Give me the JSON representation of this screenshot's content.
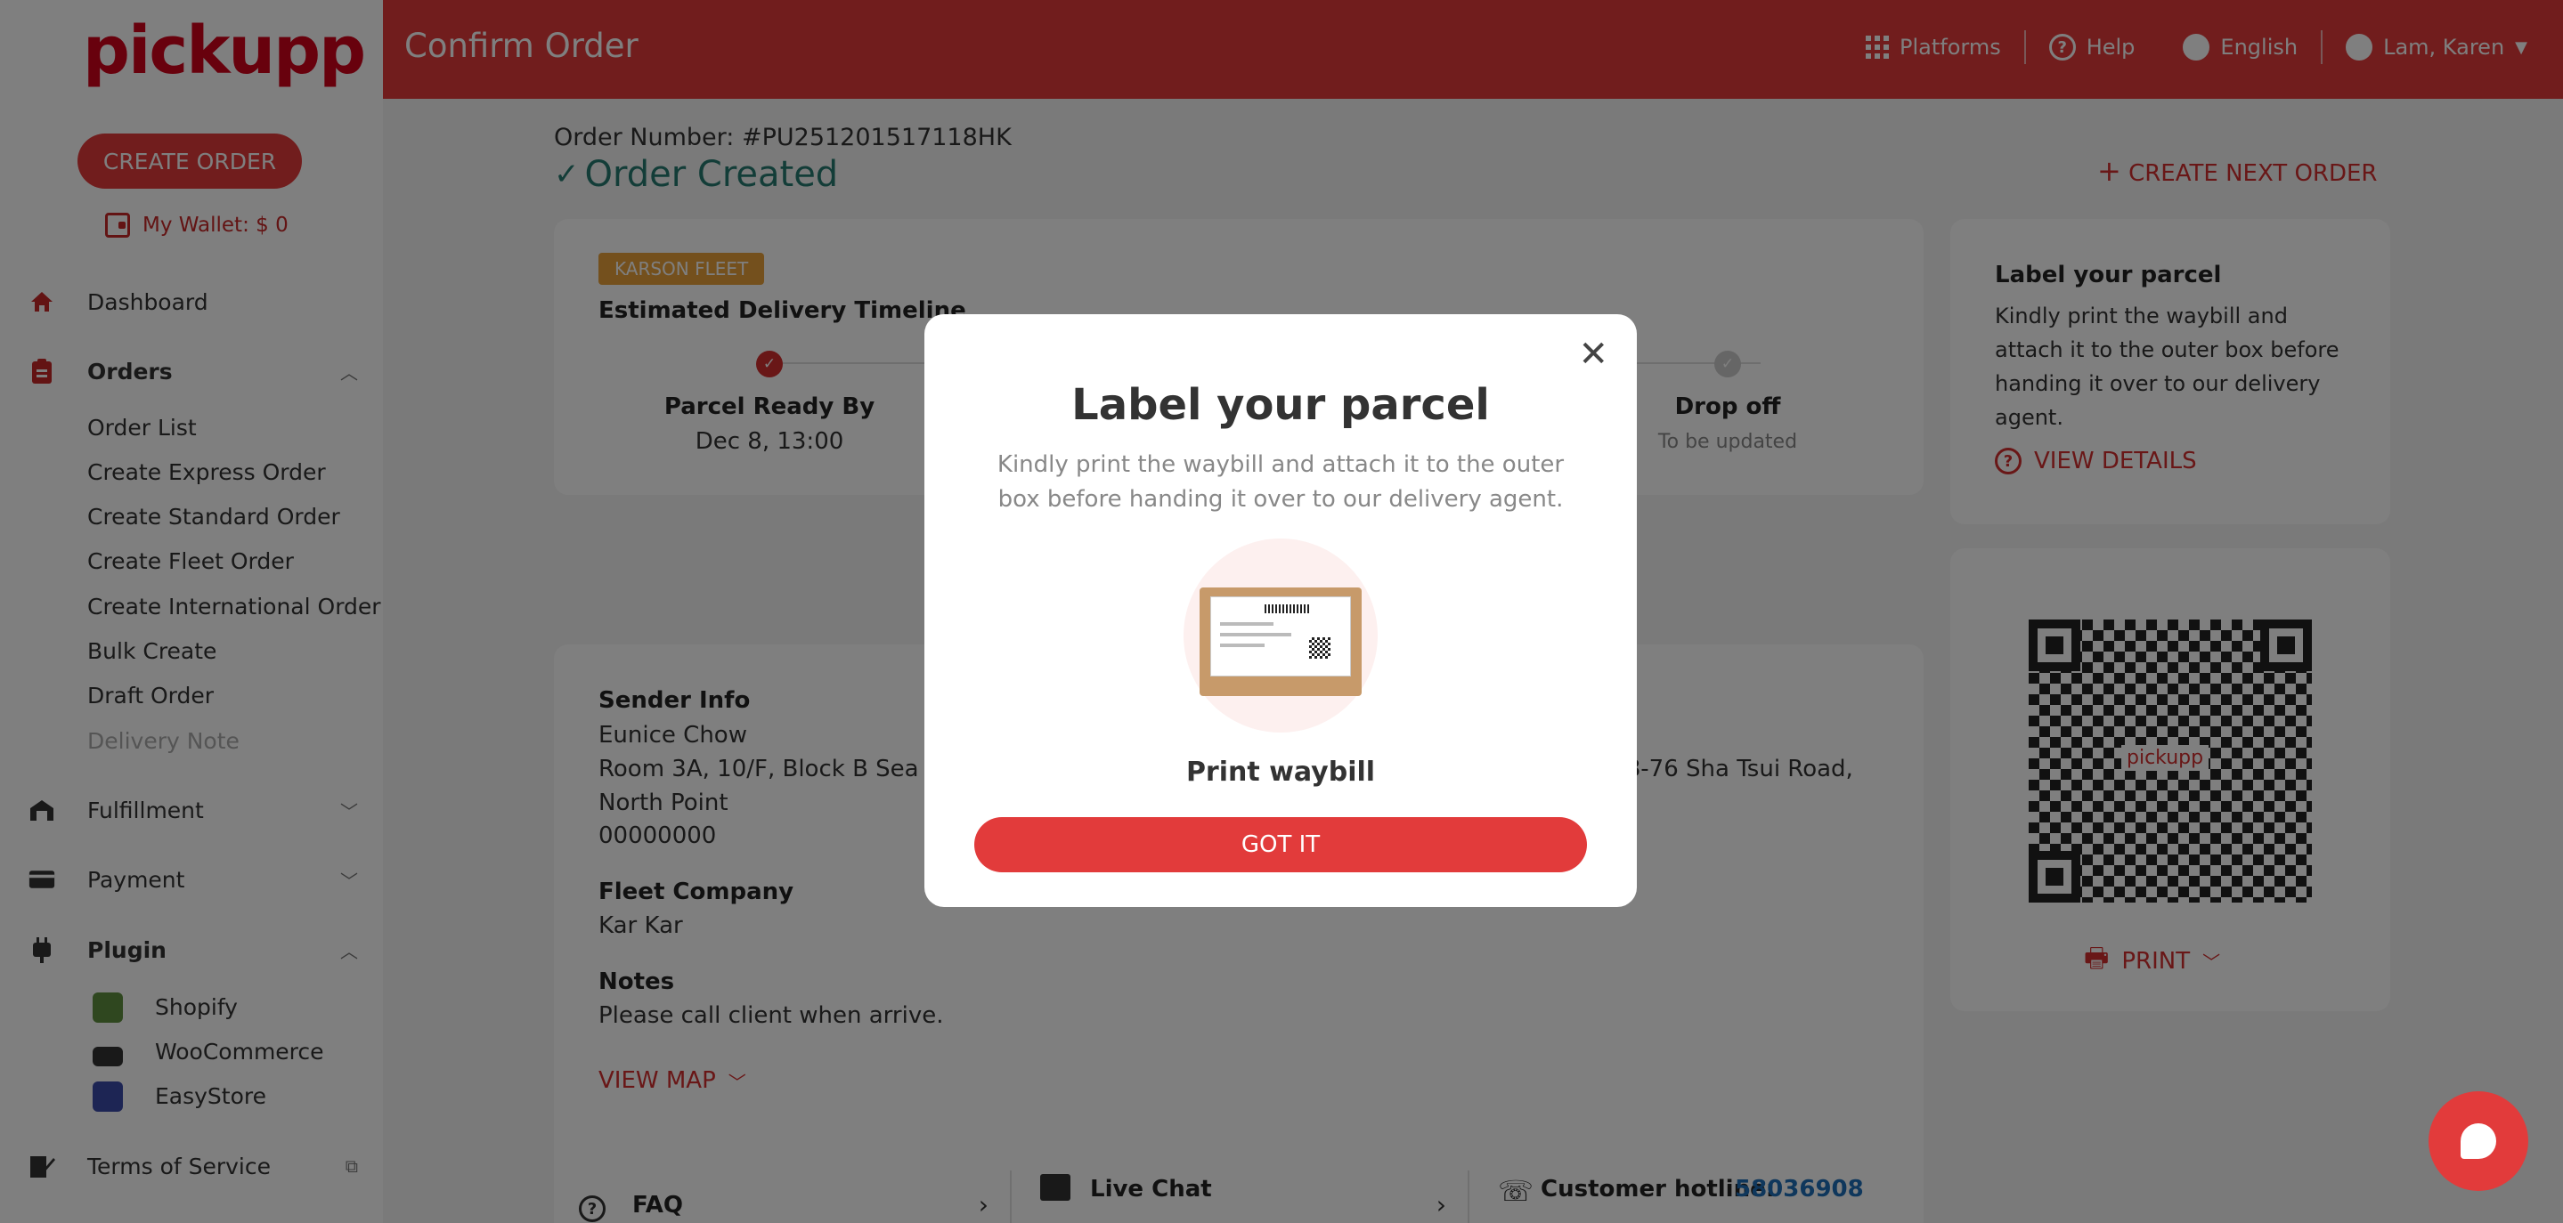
{
  "app": {
    "logo": "pickupp",
    "page_title": "Confirm Order"
  },
  "sidebar": {
    "create_order": "CREATE ORDER",
    "wallet": "My Wallet: $ 0",
    "dashboard": "Dashboard",
    "orders": "Orders",
    "order_items": [
      "Order List",
      "Create Express Order",
      "Create Standard Order",
      "Create Fleet Order",
      "Create International Order",
      "Bulk Create",
      "Draft Order",
      "Delivery Note"
    ],
    "fulfillment": "Fulfillment",
    "payment": "Payment",
    "plugin": "Plugin",
    "plugins": [
      "Shopify",
      "WooCommerce",
      "EasyStore"
    ],
    "terms": "Terms of Service"
  },
  "topbar": {
    "platforms": "Platforms",
    "help": "Help",
    "language": "English",
    "user": "Lam, Karen"
  },
  "order": {
    "number": "Order Number: #PU251201517118HK",
    "status": "Order Created",
    "create_next": "CREATE NEXT ORDER",
    "fleet_badge": "KARSON FLEET",
    "timeline_title": "Estimated Delivery Timeline",
    "ready_label": "Parcel Ready By",
    "ready_time": "Dec 8, 13:00",
    "dropoff_label": "Drop off",
    "dropoff_time": "To be updated",
    "sender_title": "Sender Info",
    "sender_name": "Eunice Chow",
    "sender_addr1": "Room 3A, 10/F, Block B Sea View",
    "sender_addr2": "North Point",
    "sender_phone": "00000000",
    "receiver_addr_fragment": "r, 68-76 Sha Tsui Road,",
    "fleet_title": "Fleet Company",
    "fleet_name": "Kar Kar",
    "notes_title": "Notes",
    "notes": "Please call client when arrive.",
    "view_map": "VIEW MAP"
  },
  "label_card": {
    "title": "Label your parcel",
    "text": "Kindly print the waybill and attach it to the outer box before handing it over to our delivery agent.",
    "view_details": "VIEW DETAILS",
    "qr_logo": "pickupp",
    "print": "PRINT"
  },
  "footer": {
    "faq": "FAQ",
    "live_chat": "Live Chat",
    "hotline_label": "Customer hotline:",
    "hotline_number": "58036908"
  },
  "modal": {
    "title": "Label your parcel",
    "desc": "Kindly print the waybill and attach it to the outer box before handing it over to our delivery agent.",
    "print_title": "Print waybill",
    "button": "GOT IT"
  },
  "colors": {
    "brand": "#e23b3b",
    "success": "#267a71",
    "badge": "#e8a13a",
    "link": "#1e6fb8"
  }
}
